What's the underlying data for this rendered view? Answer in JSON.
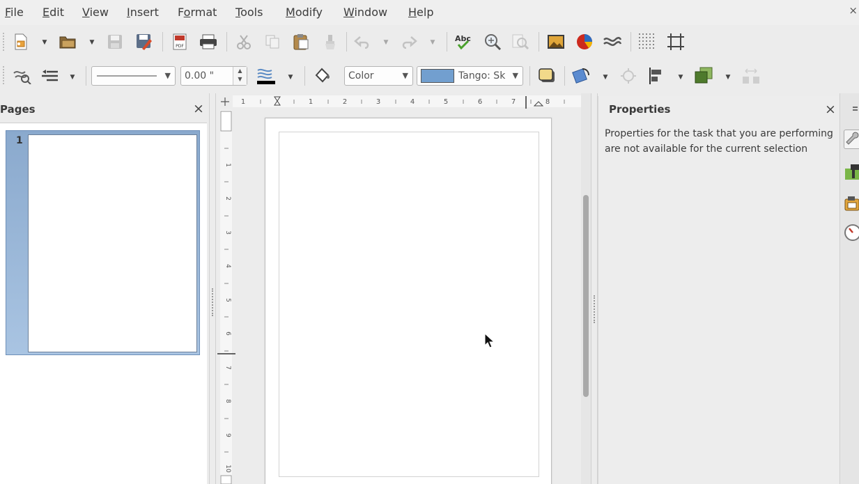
{
  "menu": [
    {
      "label": "File",
      "mnemonic": "F",
      "rest": "ile"
    },
    {
      "label": "Edit",
      "mnemonic": "E",
      "rest": "dit"
    },
    {
      "label": "View",
      "mnemonic": "V",
      "rest": "iew"
    },
    {
      "label": "Insert",
      "mnemonic": "I",
      "rest": "nsert"
    },
    {
      "label": "Format",
      "pre": "F",
      "mnemonic": "o",
      "rest": "rmat"
    },
    {
      "label": "Tools",
      "mnemonic": "T",
      "rest": "ools"
    },
    {
      "label": "Modify",
      "mnemonic": "M",
      "rest": "odify"
    },
    {
      "label": "Window",
      "mnemonic": "W",
      "rest": "indow"
    },
    {
      "label": "Help",
      "mnemonic": "H",
      "rest": "elp"
    }
  ],
  "window_close": "×",
  "toolbar2": {
    "line_width": "0.00 \"",
    "area_style": "Color",
    "fill_color_name": "Tango: Sk",
    "fill_color_hex": "#729fcf"
  },
  "pages_pane": {
    "title": "Pages",
    "close": "×",
    "slides": [
      {
        "number": "1"
      }
    ]
  },
  "ruler": {
    "h_labels": [
      "1",
      "1",
      "2",
      "3",
      "4",
      "5",
      "6",
      "7",
      "8"
    ],
    "v_labels": [
      "1",
      "2",
      "3",
      "4",
      "5",
      "6",
      "7",
      "8",
      "9",
      "10"
    ]
  },
  "properties": {
    "title": "Properties",
    "close": "×",
    "message": "Properties for the task that you are performing are not available for the current selection"
  }
}
